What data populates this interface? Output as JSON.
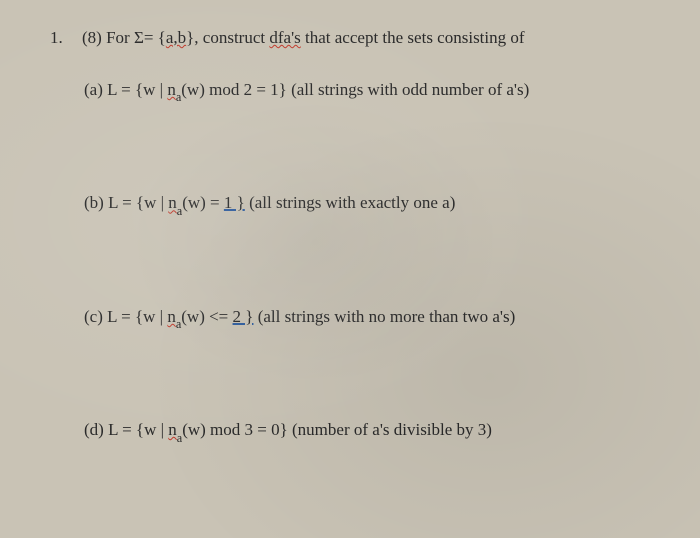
{
  "question": {
    "number": "1.",
    "points": "(8)",
    "prefix": "For Σ= {",
    "sigma_set": "a,b",
    "mid": "}, construct ",
    "dfas": "dfa's",
    "suffix": " that accept the sets consisting of"
  },
  "parts": {
    "a": {
      "label": "(a) L = {w | ",
      "na": "n",
      "na_sub": "a",
      "mid": "(w) mod 2 = 1} (all strings with odd number of a's)"
    },
    "b": {
      "label": "(b) L = {w | ",
      "na": "n",
      "na_sub": "a",
      "mid": "(w) = ",
      "val": "1 }",
      "suffix": "  (all strings with exactly one a)"
    },
    "c": {
      "label": "(c) L = {w | ",
      "na": "n",
      "na_sub": "a",
      "mid": "(w) <= ",
      "val": "2 }",
      "suffix": "  (all strings with no more than two a's)"
    },
    "d": {
      "label": "(d) L = {w | ",
      "na": "n",
      "na_sub": "a",
      "mid": "(w) mod 3 = 0} (number of a's divisible by 3)"
    }
  }
}
